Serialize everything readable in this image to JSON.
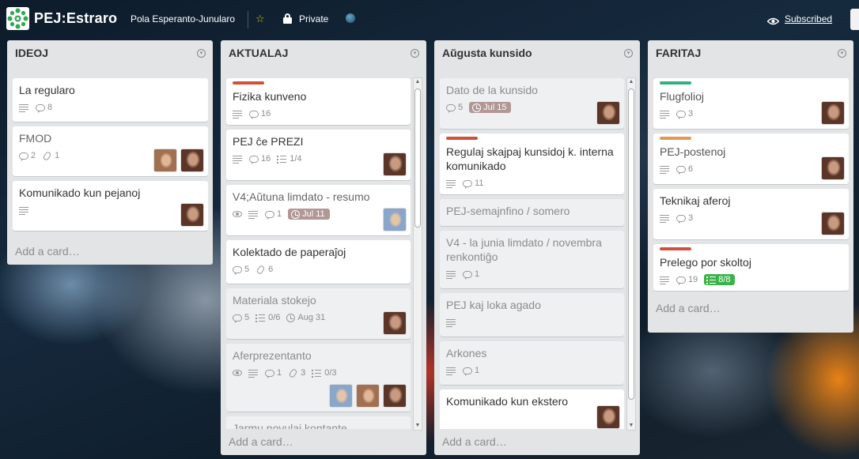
{
  "header": {
    "title": "PEJ:Estraro",
    "organization": "Pola Esperanto-Junularo",
    "privacy": "Private",
    "subscribed": "Subscribed"
  },
  "lists": [
    {
      "name": "IDEOJ",
      "add_card": "Add a card…",
      "cards": [
        {
          "title": "La regularo",
          "badges": {
            "description": true,
            "comments": "8"
          }
        },
        {
          "title": "FMOD",
          "badges": {
            "comments": "2",
            "attachments": "1"
          },
          "members": [
            "member-b",
            "member-a"
          ]
        },
        {
          "title": "Komunikado kun pejanoj",
          "badges": {
            "description": true
          },
          "members": [
            "member-a"
          ]
        }
      ]
    },
    {
      "name": "AKTUALAJ",
      "add_card": "Add a card…",
      "cards": [
        {
          "title": "Fizika kunveno",
          "label_color": "#cf513d",
          "badges": {
            "description": true,
            "comments": "16"
          }
        },
        {
          "title": "PEJ ĉe PREZI",
          "badges": {
            "description": true,
            "comments": "16",
            "checklist": "1/4"
          },
          "members": [
            "member-a"
          ]
        },
        {
          "title": "V4;Aŭtuna limdato - resumo",
          "badges": {
            "watch": true,
            "description": true,
            "comments": "1",
            "due": "Jul 11"
          },
          "members": [
            "member-c"
          ]
        },
        {
          "title": "Kolektado de paperaĵoj",
          "badges": {
            "comments": "5",
            "attachments": "6"
          }
        },
        {
          "title": "Materiala stokejo",
          "faded": true,
          "badges": {
            "comments": "5",
            "checklist": "0/6",
            "due_plain": "Aug 31"
          },
          "members": [
            "member-a"
          ]
        },
        {
          "title": "Aferprezentanto",
          "faded": true,
          "badges": {
            "watch": true,
            "description": true,
            "comments": "1",
            "attachments": "3",
            "checklist": "0/3"
          },
          "members": [
            "member-c",
            "member-b",
            "member-a"
          ]
        },
        {
          "title": "Jarmu novulai kontante",
          "faded": true
        }
      ]
    },
    {
      "name": "Aŭgusta kunsido",
      "add_card": "Add a card…",
      "cards": [
        {
          "title": "Dato de la kunsido",
          "faded": true,
          "badges": {
            "comments": "5",
            "due": "Jul 15"
          },
          "members": [
            "member-a"
          ]
        },
        {
          "title": "Regulaj skajpaj kunsidoj k. interna komunikado",
          "label_color": "#cf513d",
          "badges": {
            "description": true,
            "comments": "11"
          }
        },
        {
          "title": "PEJ-semajnfino / somero",
          "faded": true
        },
        {
          "title": "V4 - la junia limdato / novembra renkontiĝo",
          "faded": true,
          "badges": {
            "description": true,
            "comments": "1"
          }
        },
        {
          "title": "PEJ kaj loka agado",
          "faded": true,
          "badges": {
            "description": true
          }
        },
        {
          "title": "Arkones",
          "faded": true,
          "badges": {
            "description": true,
            "comments": "1"
          }
        },
        {
          "title": "Komunikado kun ekstero",
          "members": [
            "member-a"
          ]
        }
      ]
    },
    {
      "name": "FARITAJ",
      "add_card": "Add a card…",
      "cards": [
        {
          "title": "Flugfolioj",
          "label_color": "#34b27d",
          "badges": {
            "description": true,
            "comments": "3"
          },
          "members": [
            "member-a"
          ]
        },
        {
          "title": "PEJ-postenoj",
          "label_color": "#e09952",
          "badges": {
            "description": true,
            "comments": "6"
          },
          "members": [
            "member-a"
          ]
        },
        {
          "title": "Teknikaj aferoj",
          "badges": {
            "description": true,
            "comments": "3"
          },
          "members": [
            "member-a"
          ]
        },
        {
          "title": "Prelego por skoltoj",
          "label_color": "#cf513d",
          "badges": {
            "description": true,
            "comments": "19",
            "checklist_complete": "8/8"
          }
        }
      ]
    }
  ],
  "colors": {
    "list_bg": "#e2e4e6",
    "label_red": "#cf513d",
    "label_green": "#34b27d",
    "label_orange": "#e09952",
    "due_badge": "#b19795",
    "checklist_complete": "#3cb34a",
    "star": "#e3c200"
  }
}
